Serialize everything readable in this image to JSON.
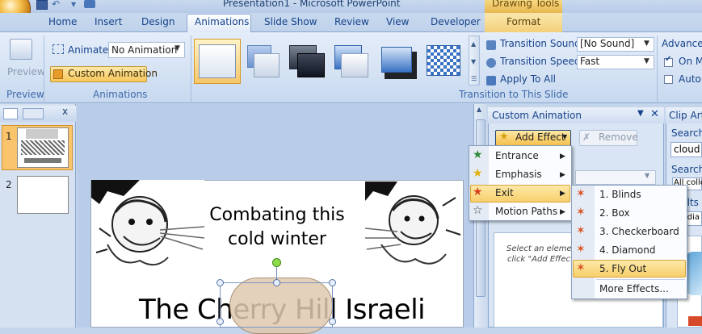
{
  "app": {
    "title": "Presentation1 - Microsoft PowerPoint",
    "contextual_tab_group": "Drawing Tools"
  },
  "tabs": [
    "Home",
    "Insert",
    "Design",
    "Animations",
    "Slide Show",
    "Review",
    "View",
    "Developer",
    "Format"
  ],
  "active_tab": "Animations",
  "ribbon": {
    "preview": {
      "label": "Preview",
      "group": "Preview"
    },
    "animations": {
      "animate_label": "Animate:",
      "animate_value": "No Animation",
      "custom_animation": "Custom Animation",
      "group": "Animations"
    },
    "transition": {
      "sound_label": "Transition Sound:",
      "sound_value": "[No Sound]",
      "speed_label": "Transition Speed:",
      "speed_value": "Fast",
      "apply_all": "Apply To All",
      "group": "Transition to This Slide"
    },
    "advance": {
      "label": "Advance S",
      "on_mouse": "On M",
      "on_mouse_checked": true,
      "automatic": "Autor",
      "automatic_checked": false
    }
  },
  "slides_pane": {
    "close": "x",
    "slides": [
      {
        "number": "1",
        "selected": true
      },
      {
        "number": "2",
        "selected": false
      }
    ]
  },
  "slide": {
    "subtitle_line1": "Combating this",
    "subtitle_line2": "cold winter",
    "heading": "The Cherry Hill Israeli"
  },
  "custom_animation": {
    "title": "Custom Animation",
    "add_effect": "Add Effect",
    "remove": "Remove",
    "hint_line1": "Select an elemen",
    "hint_line2": "click \"Add Effect"
  },
  "add_effect_menu": {
    "items": [
      {
        "label": "Entrance",
        "accel": "E",
        "icon": "green-star-icon",
        "color": "#2e8b3a"
      },
      {
        "label": "Emphasis",
        "accel": "m",
        "icon": "yellow-star-icon",
        "color": "#e0b10c"
      },
      {
        "label": "Exit",
        "accel": "x",
        "icon": "red-star-icon",
        "color": "#d8401e",
        "highlighted": true
      },
      {
        "label": "Motion Paths",
        "accel": "P",
        "icon": "outline-star-icon",
        "color": "#444444"
      }
    ]
  },
  "exit_submenu": {
    "items": [
      "1. Blinds",
      "2. Box",
      "3. Checkerboard",
      "4. Diamond",
      "5. Fly Out"
    ],
    "highlighted": "5. Fly Out",
    "more": "More Effects..."
  },
  "clip_art": {
    "title": "Clip Art",
    "search_for_label": "Search f",
    "search_value": "cloud",
    "search_in_label": "Search i",
    "collection_value": "All colle",
    "results_label": "ults",
    "media_value": "Media"
  },
  "colors": {
    "ribbon_bg": "#d6e3f4",
    "tab_text": "#15428b",
    "highlight": "#f8cf6b",
    "contextual_tab": "#f2d07a"
  }
}
